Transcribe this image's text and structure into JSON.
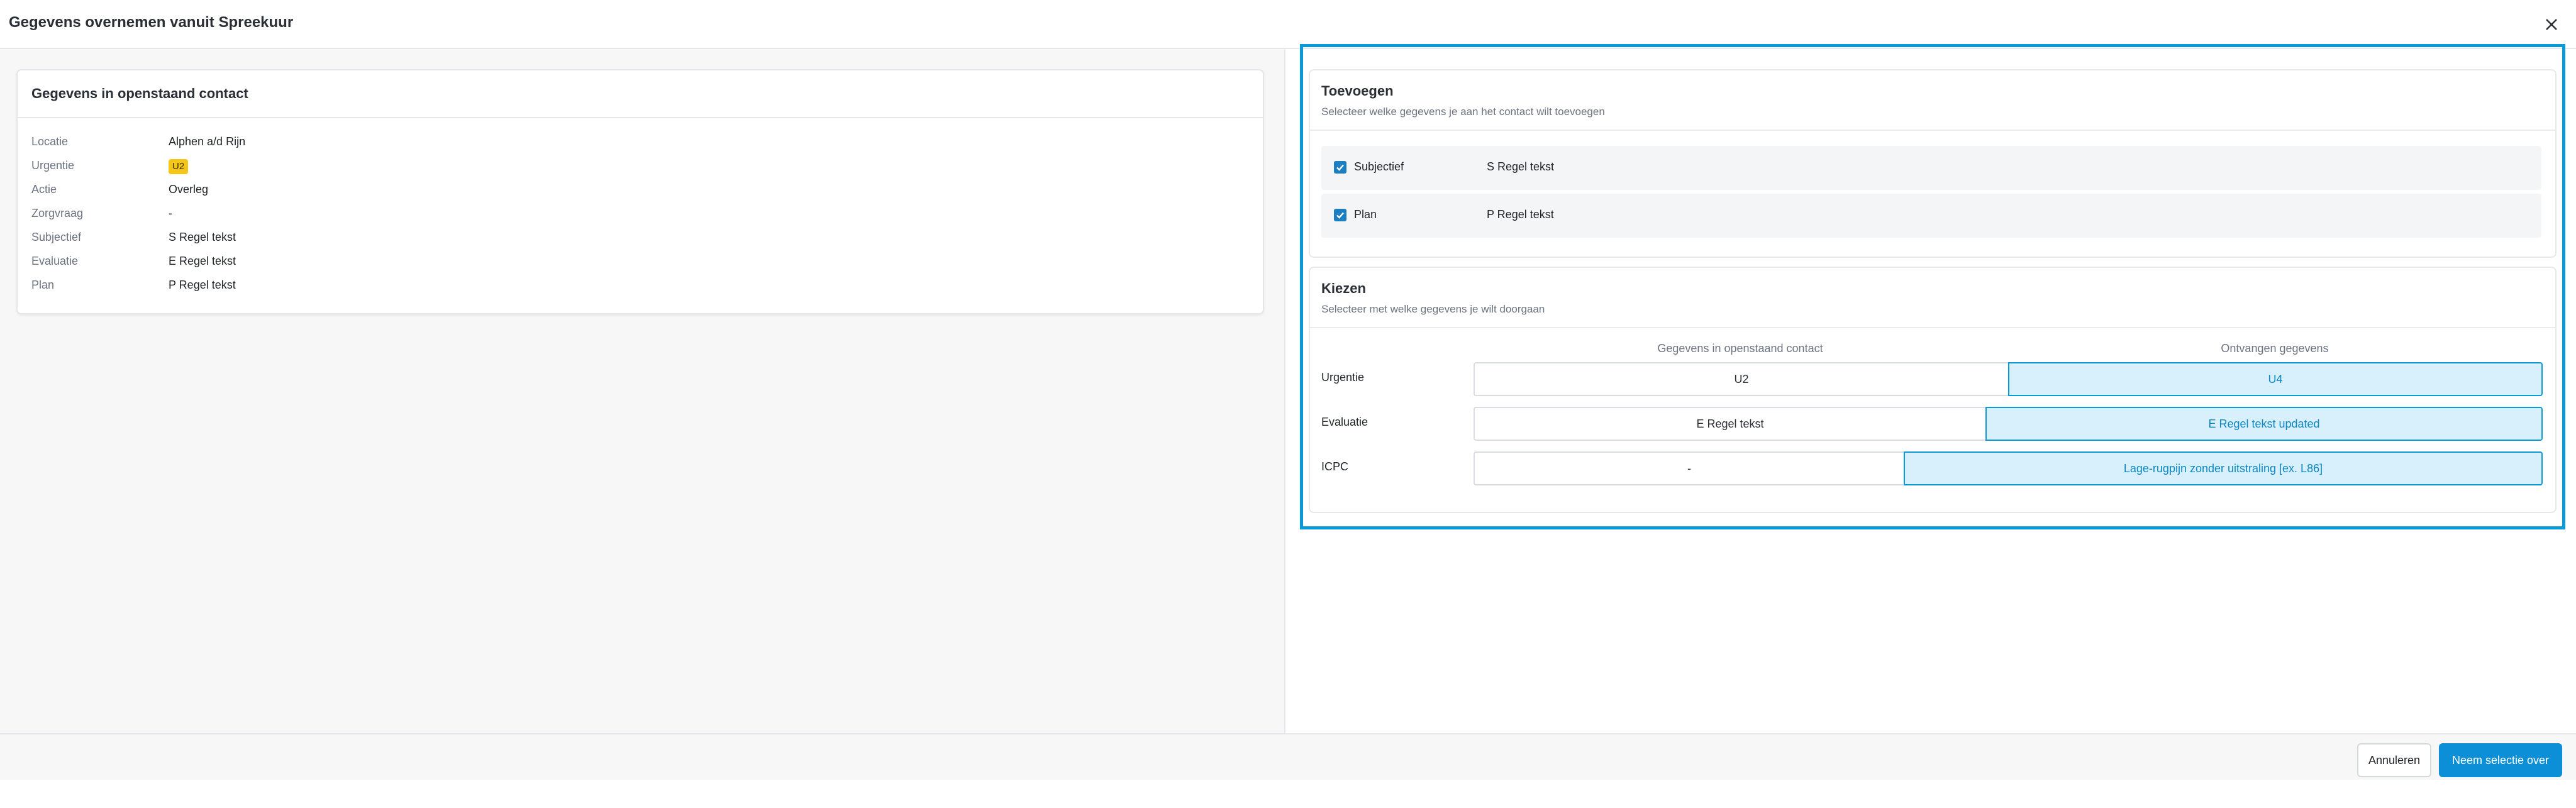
{
  "dialog": {
    "title": "Gegevens overnemen vanuit Spreekuur"
  },
  "open_contact": {
    "title": "Gegevens in openstaand contact",
    "rows": [
      {
        "label": "Locatie",
        "value": "Alphen a/d Rijn"
      },
      {
        "label": "Urgentie",
        "value": "U2"
      },
      {
        "label": "Actie",
        "value": "Overleg"
      },
      {
        "label": "Zorgvraag",
        "value": "-"
      },
      {
        "label": "Subjectief",
        "value": "S Regel tekst"
      },
      {
        "label": "Evaluatie",
        "value": "E Regel tekst"
      },
      {
        "label": "Plan",
        "value": "P Regel tekst"
      }
    ],
    "urgency_color": "#f5c518"
  },
  "toevoegen": {
    "title": "Toevoegen",
    "subtitle": "Selecteer welke gegevens je aan het contact wilt toevoegen",
    "items": [
      {
        "label": "Subjectief",
        "value": "S Regel tekst",
        "checked": true
      },
      {
        "label": "Plan",
        "value": "P Regel tekst",
        "checked": true
      }
    ]
  },
  "kiezen": {
    "title": "Kiezen",
    "subtitle": "Selecteer met welke gegevens je wilt doorgaan",
    "col_current": "Gegevens in openstaand contact",
    "col_received": "Ontvangen gegevens",
    "rows": [
      {
        "label": "Urgentie",
        "current": "U2",
        "received": "U4",
        "selected": "received"
      },
      {
        "label": "Evaluatie",
        "current": "E Regel tekst",
        "received": "E Regel tekst updated",
        "selected": "received"
      },
      {
        "label": "ICPC",
        "current": "-",
        "received": "Lage-rugpijn zonder uitstraling [ex. L86]",
        "selected": "received"
      }
    ]
  },
  "footer": {
    "cancel_label": "Annuleren",
    "confirm_label": "Neem selectie over"
  },
  "colors": {
    "accent": "#0c9ad7",
    "primary_button": "#0c8fd6",
    "selected_bg": "#d8f0fb"
  }
}
